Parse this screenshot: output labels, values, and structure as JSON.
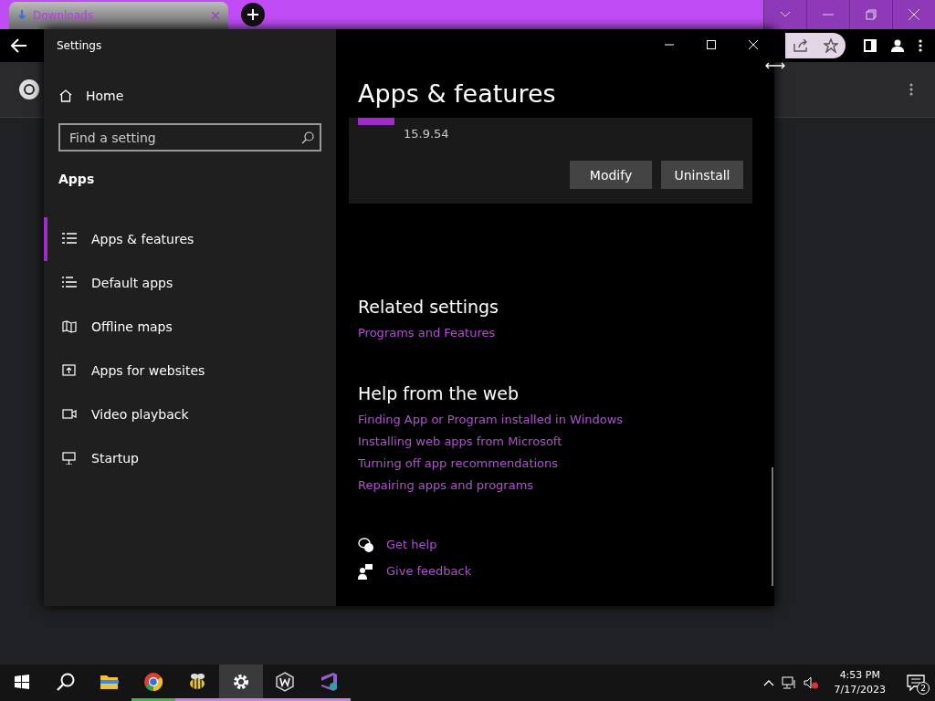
{
  "browser": {
    "tab": {
      "title": "Downloads",
      "selected": true
    }
  },
  "settings": {
    "title": "Settings",
    "home": "Home",
    "search": {
      "placeholder": "Find a setting"
    },
    "section": "Apps",
    "nav": [
      {
        "kind": "list",
        "label": "Apps & features",
        "selected": true
      },
      {
        "kind": "defaults",
        "label": "Default apps",
        "selected": false
      },
      {
        "kind": "map",
        "label": "Offline maps",
        "selected": false
      },
      {
        "kind": "web",
        "label": "Apps for websites",
        "selected": false
      },
      {
        "kind": "video",
        "label": "Video playback",
        "selected": false
      },
      {
        "kind": "startup",
        "label": "Startup",
        "selected": false
      }
    ],
    "page_title": "Apps & features",
    "app_card": {
      "version": "15.9.54",
      "buttons": [
        "Modify",
        "Uninstall"
      ]
    },
    "related": {
      "heading": "Related settings",
      "links": [
        "Programs and Features"
      ]
    },
    "help": {
      "heading": "Help from the web",
      "links": [
        "Finding App or Program installed in Windows",
        "Installing web apps from Microsoft",
        "Turning off app recommendations",
        "Repairing apps and programs"
      ]
    },
    "footer_links": [
      {
        "kind": "help",
        "label": "Get help"
      },
      {
        "kind": "feedback",
        "label": "Give feedback"
      }
    ]
  },
  "taskbar": {
    "apps": [
      {
        "kind": "explorer",
        "running": false,
        "selected": false
      },
      {
        "kind": "chrome",
        "running": true,
        "selected": false
      },
      {
        "kind": "bee",
        "running": true,
        "selected": false
      },
      {
        "kind": "settings",
        "running": true,
        "selected": true
      },
      {
        "kind": "w",
        "running": true,
        "selected": false
      },
      {
        "kind": "vs",
        "running": true,
        "selected": false
      }
    ],
    "time": "4:53 PM",
    "date": "7/17/2023",
    "notifications": "2"
  }
}
